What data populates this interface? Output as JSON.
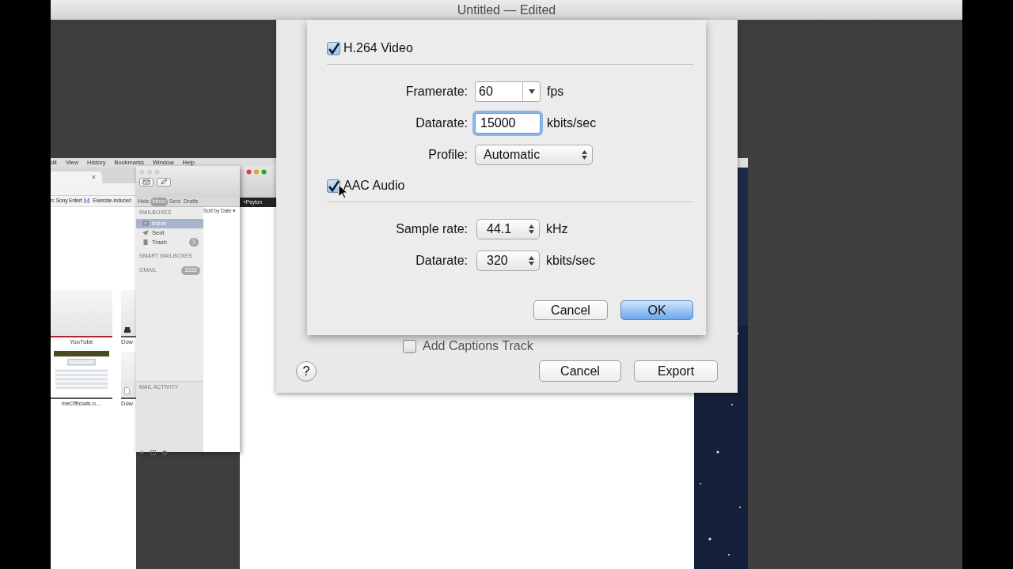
{
  "window": {
    "title": "Untitled — Edited"
  },
  "browser": {
    "menu": [
      "dit",
      "View",
      "History",
      "Bookmarks",
      "Window",
      "Help"
    ],
    "tab_close": "×",
    "bookmarks": [
      {
        "label": "n: Sony Entert"
      },
      {
        "label": "Exercise-Induced",
        "icon": "M"
      }
    ],
    "top_sites": [
      {
        "label": "YouTube",
        "kind": "video"
      },
      {
        "label": "Dow",
        "kind": "download"
      },
      {
        "label": "meOfficials.n…",
        "kind": "page"
      },
      {
        "label": "Dow",
        "kind": "file"
      }
    ]
  },
  "mail": {
    "hide": "Hide",
    "tabs": [
      {
        "label": "Inbox",
        "selected": true
      },
      {
        "label": "Sent",
        "selected": false
      },
      {
        "label": "Drafts",
        "selected": false
      }
    ],
    "sort": "Sort by Date ▾",
    "mailboxes_title": "MAILBOXES",
    "mailboxes": [
      {
        "label": "Inbox",
        "kind": "inbox",
        "selected": true
      },
      {
        "label": "Sent",
        "kind": "sent",
        "selected": false
      },
      {
        "label": "Trash",
        "kind": "trash",
        "count": "1",
        "selected": false
      }
    ],
    "smart_title": "SMART MAILBOXES",
    "account": {
      "label": "GMAIL",
      "count": "2222"
    },
    "activity": "MAIL ACTIVITY"
  },
  "other_window": {
    "tag": "+Peyton"
  },
  "sheet": {
    "sections": [
      {
        "label": "H.264 Video",
        "checked": true,
        "fields": [
          {
            "label": "Framerate:",
            "kind": "combo",
            "value": "60",
            "unit": "fps",
            "focused": false
          },
          {
            "label": "Datarate:",
            "kind": "text",
            "value": "15000",
            "unit": "kbits/sec",
            "focused": true
          },
          {
            "label": "Profile:",
            "kind": "popup",
            "value": "Automatic",
            "focused": false
          }
        ]
      },
      {
        "label": "AAC Audio",
        "checked": true,
        "fields": [
          {
            "label": "Sample rate:",
            "kind": "stepper",
            "value": "44.1",
            "unit": "kHz",
            "focused": false
          },
          {
            "label": "Datarate:",
            "kind": "stepper",
            "value": "320",
            "unit": "kbits/sec",
            "focused": false
          }
        ]
      }
    ],
    "buttons": [
      {
        "label": "Cancel",
        "default": false
      },
      {
        "label": "OK",
        "default": true
      }
    ]
  },
  "export_dialog": {
    "options": [
      {
        "label": "Add Captions Track",
        "checked": false
      }
    ],
    "help": "?",
    "buttons": [
      {
        "label": "Cancel"
      },
      {
        "label": "Export"
      }
    ]
  }
}
